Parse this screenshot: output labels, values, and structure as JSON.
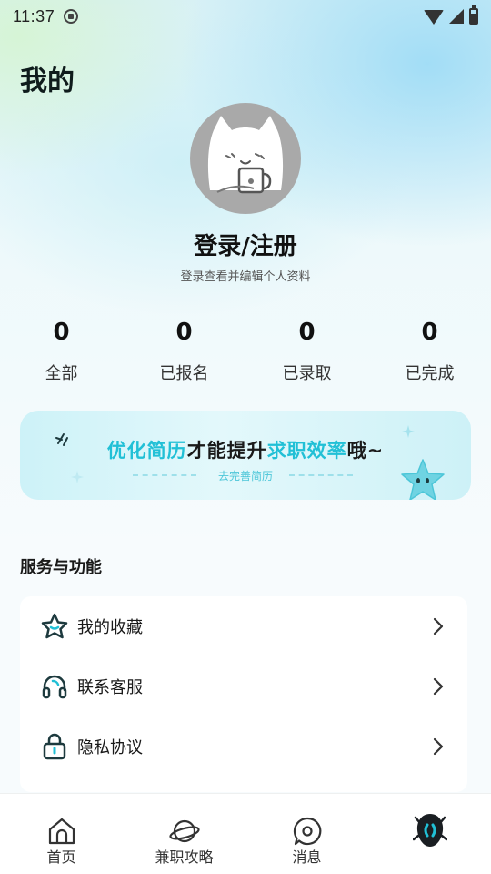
{
  "status_bar": {
    "time": "11:37"
  },
  "header": {
    "title": "我的"
  },
  "profile": {
    "login_label": "登录/注册",
    "login_subtitle": "登录查看并编辑个人资料"
  },
  "stats": [
    {
      "value": "0",
      "label": "全部"
    },
    {
      "value": "0",
      "label": "已报名"
    },
    {
      "value": "0",
      "label": "已录取"
    },
    {
      "value": "0",
      "label": "已完成"
    }
  ],
  "banner": {
    "part1": "优化简历",
    "part2": "才能提升",
    "part3": "求职效率",
    "part4": "哦~",
    "subtitle": "去完善简历"
  },
  "services": {
    "title": "服务与功能",
    "items": [
      {
        "label": "我的收藏",
        "icon": "star-icon"
      },
      {
        "label": "联系客服",
        "icon": "headset-icon"
      },
      {
        "label": "隐私协议",
        "icon": "lock-icon"
      }
    ]
  },
  "tabbar": {
    "items": [
      {
        "label": "首页",
        "icon": "home-icon"
      },
      {
        "label": "兼职攻略",
        "icon": "planet-icon"
      },
      {
        "label": "消息",
        "icon": "message-icon"
      },
      {
        "label": "",
        "icon": "mine-icon"
      }
    ]
  },
  "colors": {
    "accent": "#21c0d6",
    "icon_dark": "#1d3a3e",
    "avatar_bg": "#a9a9a9"
  }
}
